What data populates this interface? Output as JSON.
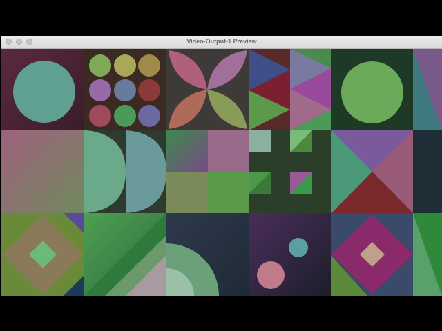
{
  "window": {
    "title": "Video-Output-1 Preview",
    "traffic_lights": [
      "close-button",
      "minimize-button",
      "zoom-button"
    ]
  },
  "preview": {
    "description_grid": {
      "rows": 3,
      "columns": 6
    },
    "tiles": [
      {
        "name": "tile-circle-on-maroon",
        "motif": "circle"
      },
      {
        "name": "tile-nine-dots",
        "motif": "dot-grid"
      },
      {
        "name": "tile-four-petal-flower",
        "motif": "petals"
      },
      {
        "name": "tile-triangle-stack",
        "motif": "triangles"
      },
      {
        "name": "tile-pinwheel-triangles",
        "motif": "triangles"
      },
      {
        "name": "tile-green-circle",
        "motif": "circle"
      },
      {
        "name": "tile-diagonal-edge",
        "motif": "triangle"
      },
      {
        "name": "tile-gradient-square",
        "motif": "gradient"
      },
      {
        "name": "tile-double-half-circles",
        "motif": "half-circles"
      },
      {
        "name": "tile-quadrant-squares",
        "motif": "squares"
      },
      {
        "name": "tile-hash-pattern",
        "motif": "hash"
      },
      {
        "name": "tile-bowtie-triangles",
        "motif": "triangles"
      },
      {
        "name": "tile-dark-teal-strip",
        "motif": "solid"
      },
      {
        "name": "tile-diamond-in-square",
        "motif": "diamond"
      },
      {
        "name": "tile-diagonal-bands",
        "motif": "diagonal"
      },
      {
        "name": "tile-concentric-half-circles",
        "motif": "arcs"
      },
      {
        "name": "tile-two-dots",
        "motif": "dots"
      },
      {
        "name": "tile-magenta-diamond",
        "motif": "diamond"
      },
      {
        "name": "tile-green-wedge",
        "motif": "triangle"
      }
    ]
  }
}
